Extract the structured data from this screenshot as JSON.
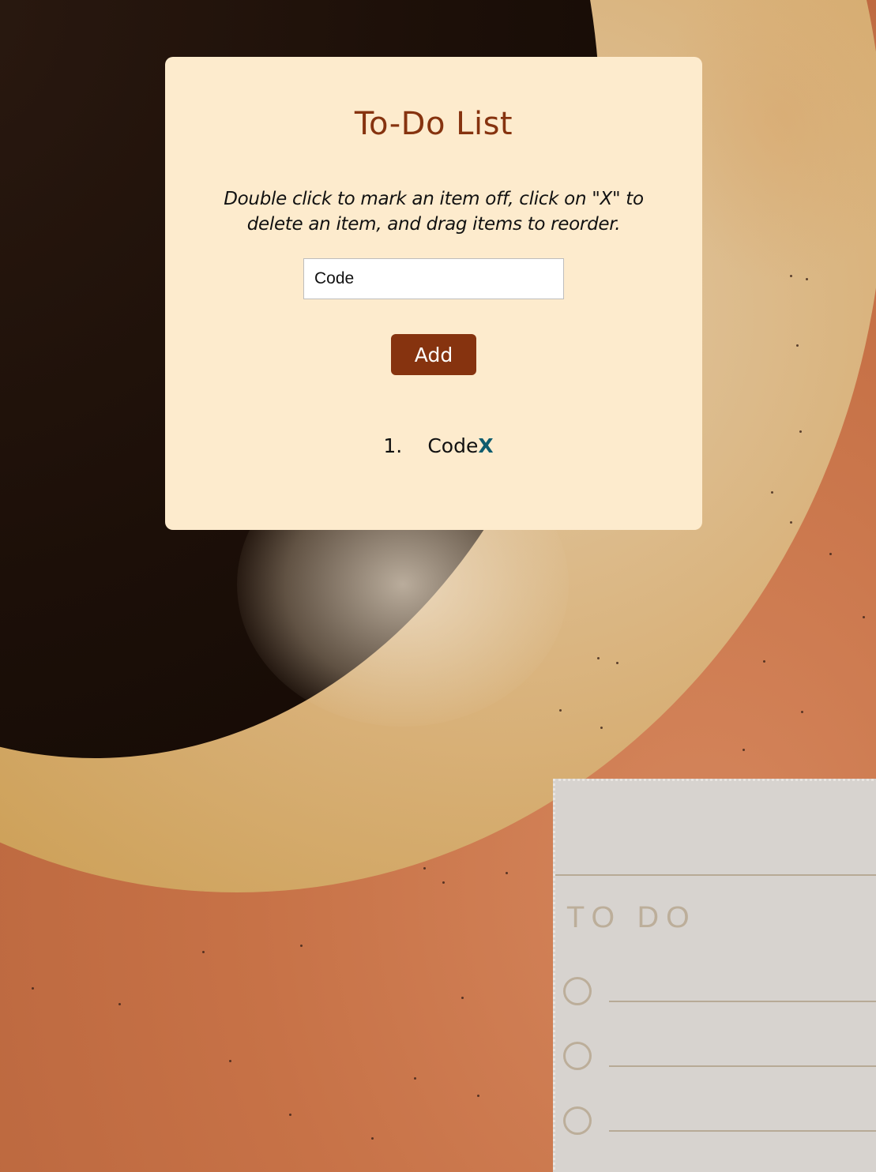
{
  "app": {
    "title": "To-Do List",
    "instructions": "Double click to mark an item off, click on \"X\" to delete an item, and drag items to reorder."
  },
  "form": {
    "input_value": "Code",
    "add_label": "Add"
  },
  "todos": [
    {
      "number": "1.",
      "text": "Code",
      "delete_label": "X"
    }
  ],
  "background": {
    "note_title": "TO DO"
  },
  "colors": {
    "card": "#fdebcd",
    "accent": "#86330f",
    "delete": "#0f5c6e"
  }
}
